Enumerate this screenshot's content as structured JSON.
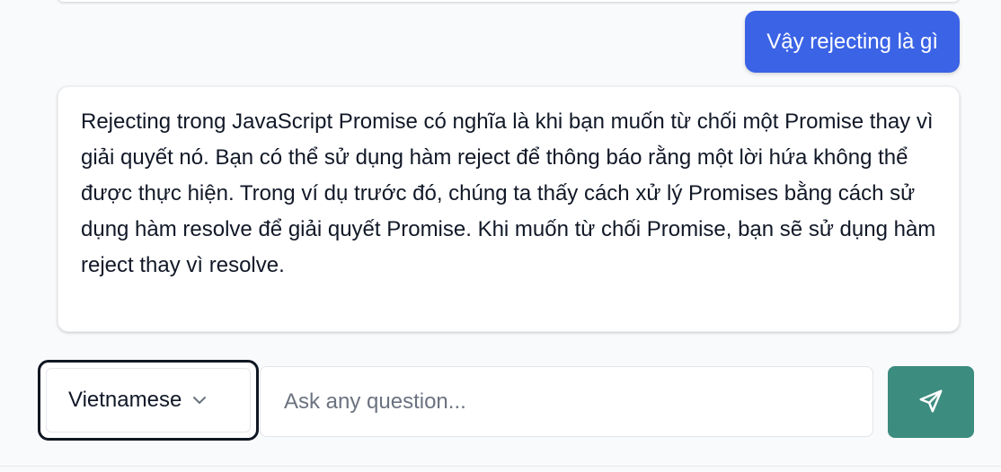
{
  "chat": {
    "user_message": "Vậy rejecting là gì",
    "assistant_message": "Rejecting trong JavaScript Promise có nghĩa là khi bạn muốn từ chối một Promise thay vì giải quyết nó. Bạn có thể sử dụng hàm reject để thông báo rằng một lời hứa không thể được thực hiện. Trong ví dụ trước đó, chúng ta thấy cách xử lý Promises bằng cách sử dụng hàm resolve để giải quyết Promise. Khi muốn từ chối Promise, bạn sẽ sử dụng hàm reject thay vì resolve."
  },
  "input_bar": {
    "language": {
      "selected": "Vietnamese",
      "icon": "chevron-down-icon"
    },
    "question_placeholder": "Ask any question...",
    "question_value": "",
    "send_icon": "send-icon"
  },
  "colors": {
    "user_bubble": "#3b63e6",
    "send_button": "#3c8c7f",
    "select_focus_border": "#0f1722"
  }
}
